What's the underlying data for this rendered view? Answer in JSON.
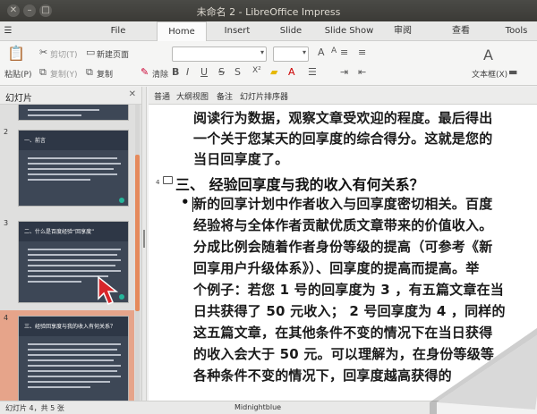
{
  "window": {
    "title": "未命名 2 - LibreOffice Impress"
  },
  "tabs": [
    {
      "label": "File"
    },
    {
      "label": "Home"
    },
    {
      "label": "Insert"
    },
    {
      "label": "Slide"
    },
    {
      "label": "Slide Show"
    },
    {
      "label": "审阅"
    },
    {
      "label": "查看"
    },
    {
      "label": "Tools"
    }
  ],
  "ribbon": {
    "paste_label": "粘贴(P)",
    "cut_label": "剪切(T)",
    "copy_label": "复制(Y)",
    "new_slide_label": "新建页面",
    "duplicate_label": "复制",
    "clear_label": "清除",
    "textbox_label": "文本框(X)"
  },
  "panel": {
    "title": "幻灯片",
    "slides": [
      {
        "num": "2",
        "title": "一、前言"
      },
      {
        "num": "3",
        "title": "二、什么是百度经验“回享度”"
      },
      {
        "num": "4",
        "title": "三、经验回享度与我的收入有何关系？"
      }
    ]
  },
  "view_tabs": [
    "普通",
    "大纲视图",
    "备注",
    "幻灯片排序器"
  ],
  "outline": {
    "para1": [
      "阅读行为数据，观察文章受欢迎的程度。最后得出",
      "一个关于您某天的回享度的综合得分。这就是您的",
      "当日回享度了。"
    ],
    "slide_number": "4",
    "heading": "三、 经验回享度与我的收入有何关系？",
    "bullet": "•",
    "para2": [
      "新的回享计划中作者收入与回享度密切相关。百度",
      "经验将与全体作者贡献优质文章带来的价值收入。",
      "分成比例会随着作者身份等级的提高（可参考《新",
      "回享用户升级体系》）、回享度的提高而提高。举",
      "个例子：若您 1 号的回享度为 3 ，有五篇文章在当",
      "日共获得了 50 元收入； 2 号回享度为 4 ，同样的",
      "这五篇文章，在其他条件不变的情况下在当日获得",
      "的收入会大于 50 元。可以理解为，在身份等级等",
      "各种条件不变的情况下，回享度越高获得的"
    ]
  },
  "status": {
    "slide_info": "幻灯片 4，共 5 张",
    "theme": "Midnightblue"
  }
}
